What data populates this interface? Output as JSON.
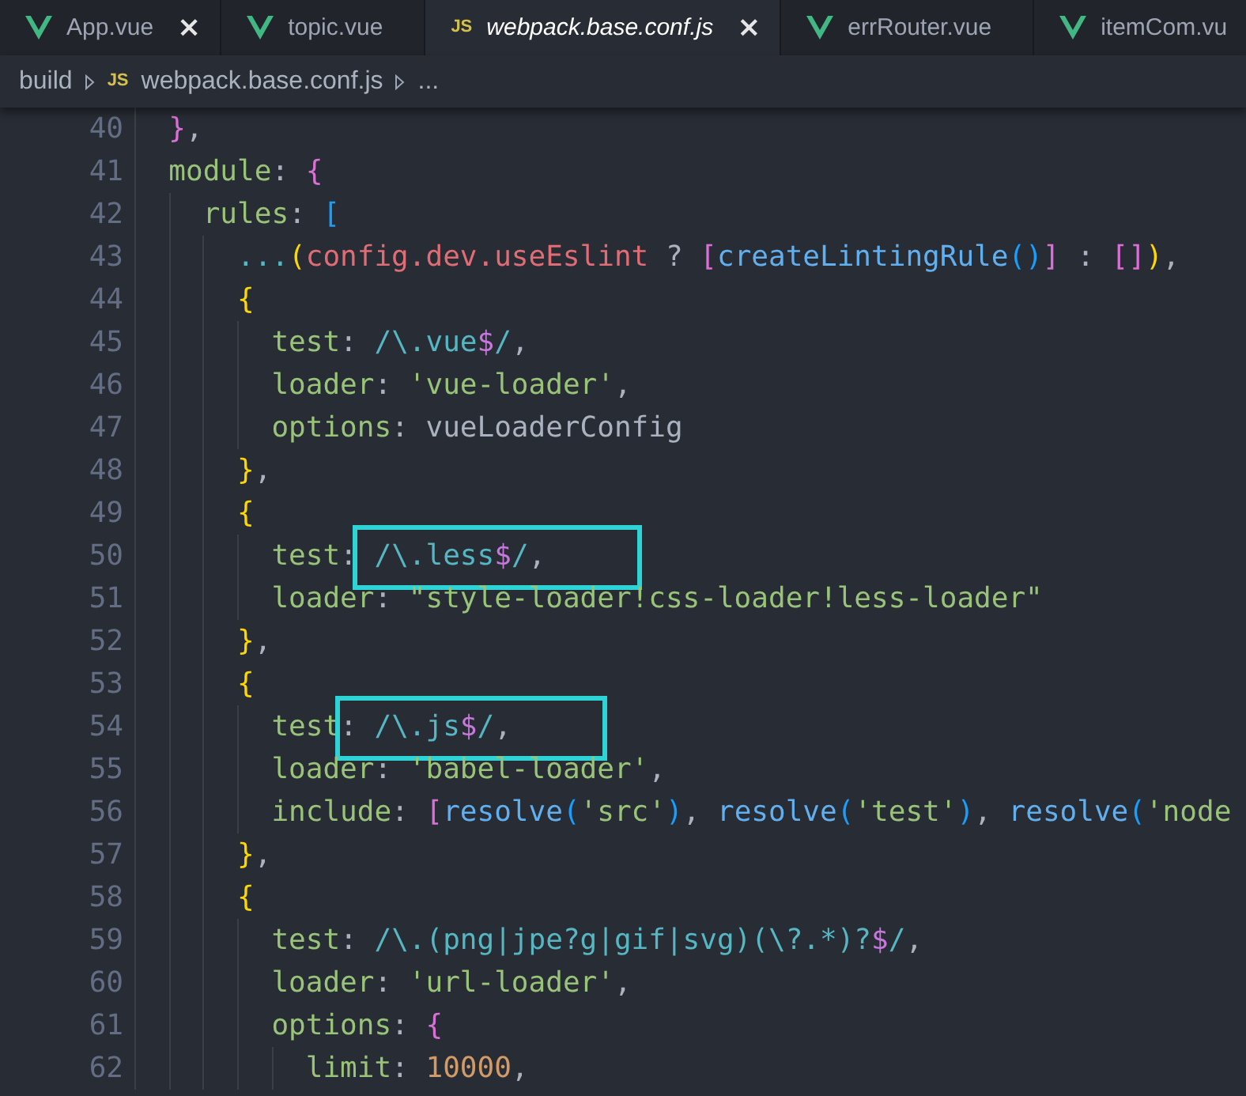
{
  "tabs": [
    {
      "label": "App.vue",
      "icon": {
        "kind": "vue"
      },
      "close": "×",
      "selected": false,
      "preview": false
    },
    {
      "label": "topic.vue",
      "icon": {
        "kind": "vue"
      },
      "selected": false,
      "preview": false
    },
    {
      "label": "webpack.base.conf.js",
      "icon": {
        "kind": "js",
        "text": "JS"
      },
      "close": "×",
      "selected": true,
      "preview": true
    },
    {
      "label": "errRouter.vue",
      "icon": {
        "kind": "vue"
      },
      "selected": false,
      "preview": false
    },
    {
      "label": "itemCom.vu",
      "icon": {
        "kind": "vue"
      },
      "selected": false,
      "preview": false
    }
  ],
  "breadcrumb": [
    {
      "label": "build"
    },
    {
      "label": "webpack.base.conf.js",
      "icon": {
        "kind": "js",
        "text": "JS"
      }
    },
    {
      "label": "..."
    }
  ],
  "code_lines": [
    {
      "number": "40",
      "tokens": [
        {
          "text": "  }",
          "kind": "brace_magenta"
        },
        {
          "text": ",",
          "kind": "punct"
        }
      ]
    },
    {
      "number": "41",
      "tokens": [
        {
          "text": "  module",
          "kind": "key"
        },
        {
          "text": ": ",
          "kind": "punct"
        },
        {
          "text": "{",
          "kind": "brace_magenta"
        }
      ]
    },
    {
      "number": "42",
      "tokens": [
        {
          "text": "    rules",
          "kind": "key"
        },
        {
          "text": ": ",
          "kind": "punct"
        },
        {
          "text": "[",
          "kind": "brace_blue"
        }
      ]
    },
    {
      "number": "43",
      "tokens": [
        {
          "text": "      ...",
          "kind": "operator"
        },
        {
          "text": "(",
          "kind": "brace_yellow"
        },
        {
          "text": "config.dev.useEslint",
          "kind": "variable"
        },
        {
          "text": " ? ",
          "kind": "punct"
        },
        {
          "text": "[",
          "kind": "brace_magenta"
        },
        {
          "text": "createLintingRule",
          "kind": "function"
        },
        {
          "text": "()",
          "kind": "brace_blue"
        },
        {
          "text": "]",
          "kind": "brace_magenta"
        },
        {
          "text": " : ",
          "kind": "punct"
        },
        {
          "text": "[]",
          "kind": "brace_magenta"
        },
        {
          "text": ")",
          "kind": "brace_yellow"
        },
        {
          "text": ",",
          "kind": "punct"
        }
      ]
    },
    {
      "number": "44",
      "tokens": [
        {
          "text": "      {",
          "kind": "brace_yellow"
        }
      ]
    },
    {
      "number": "45",
      "tokens": [
        {
          "text": "        test",
          "kind": "key"
        },
        {
          "text": ": ",
          "kind": "punct"
        },
        {
          "text": "/\\.vue",
          "kind": "regex"
        },
        {
          "text": "$",
          "kind": "regex_meta"
        },
        {
          "text": "/",
          "kind": "regex"
        },
        {
          "text": ",",
          "kind": "punct"
        }
      ]
    },
    {
      "number": "46",
      "tokens": [
        {
          "text": "        loader",
          "kind": "key"
        },
        {
          "text": ": ",
          "kind": "punct"
        },
        {
          "text": "'vue-loader'",
          "kind": "string"
        },
        {
          "text": ",",
          "kind": "punct"
        }
      ]
    },
    {
      "number": "47",
      "tokens": [
        {
          "text": "        options",
          "kind": "key"
        },
        {
          "text": ": ",
          "kind": "punct"
        },
        {
          "text": "vueLoaderConfig",
          "kind": "plain"
        }
      ]
    },
    {
      "number": "48",
      "tokens": [
        {
          "text": "      }",
          "kind": "brace_yellow"
        },
        {
          "text": ",",
          "kind": "punct"
        }
      ]
    },
    {
      "number": "49",
      "tokens": [
        {
          "text": "      {",
          "kind": "brace_yellow"
        }
      ]
    },
    {
      "number": "50",
      "tokens": [
        {
          "text": "        test",
          "kind": "key"
        },
        {
          "text": ":",
          "kind": "punct"
        }
      ],
      "boxed_tokens": [
        {
          "text": " /\\.less",
          "kind": "regex"
        },
        {
          "text": "$",
          "kind": "regex_meta"
        },
        {
          "text": "/",
          "kind": "regex"
        },
        {
          "text": ",",
          "kind": "punct"
        }
      ]
    },
    {
      "number": "51",
      "tokens": [
        {
          "text": "        loader",
          "kind": "key"
        },
        {
          "text": ": ",
          "kind": "punct"
        },
        {
          "text": "\"style-loader!css-loader!less-loader\"",
          "kind": "string"
        }
      ]
    },
    {
      "number": "52",
      "tokens": [
        {
          "text": "      }",
          "kind": "brace_yellow"
        },
        {
          "text": ",",
          "kind": "punct"
        }
      ]
    },
    {
      "number": "53",
      "tokens": [
        {
          "text": "      {",
          "kind": "brace_yellow"
        }
      ]
    },
    {
      "number": "54",
      "tokens": [
        {
          "text": "        test",
          "kind": "key"
        }
      ],
      "boxed_tokens": [
        {
          "text": ": ",
          "kind": "punct"
        },
        {
          "text": "/\\.js",
          "kind": "regex"
        },
        {
          "text": "$",
          "kind": "regex_meta"
        },
        {
          "text": "/",
          "kind": "regex"
        },
        {
          "text": ",",
          "kind": "punct"
        }
      ]
    },
    {
      "number": "55",
      "tokens": [
        {
          "text": "        loader",
          "kind": "key"
        },
        {
          "text": ": ",
          "kind": "punct"
        },
        {
          "text": "'babel-loader'",
          "kind": "string"
        },
        {
          "text": ",",
          "kind": "punct"
        }
      ]
    },
    {
      "number": "56",
      "tokens": [
        {
          "text": "        include",
          "kind": "key"
        },
        {
          "text": ": ",
          "kind": "punct"
        },
        {
          "text": "[",
          "kind": "brace_magenta"
        },
        {
          "text": "resolve",
          "kind": "function"
        },
        {
          "text": "(",
          "kind": "brace_blue"
        },
        {
          "text": "'src'",
          "kind": "string"
        },
        {
          "text": ")",
          "kind": "brace_blue"
        },
        {
          "text": ", ",
          "kind": "punct"
        },
        {
          "text": "resolve",
          "kind": "function"
        },
        {
          "text": "(",
          "kind": "brace_blue"
        },
        {
          "text": "'test'",
          "kind": "string"
        },
        {
          "text": ")",
          "kind": "brace_blue"
        },
        {
          "text": ", ",
          "kind": "punct"
        },
        {
          "text": "resolve",
          "kind": "function"
        },
        {
          "text": "(",
          "kind": "brace_blue"
        },
        {
          "text": "'node",
          "kind": "string"
        }
      ]
    },
    {
      "number": "57",
      "tokens": [
        {
          "text": "      }",
          "kind": "brace_yellow"
        },
        {
          "text": ",",
          "kind": "punct"
        }
      ]
    },
    {
      "number": "58",
      "tokens": [
        {
          "text": "      {",
          "kind": "brace_yellow"
        }
      ]
    },
    {
      "number": "59",
      "tokens": [
        {
          "text": "        test",
          "kind": "key"
        },
        {
          "text": ": ",
          "kind": "punct"
        },
        {
          "text": "/\\.(png|jpe?g|gif|svg)(\\?.*)?",
          "kind": "regex"
        },
        {
          "text": "$",
          "kind": "regex_meta"
        },
        {
          "text": "/",
          "kind": "regex"
        },
        {
          "text": ",",
          "kind": "punct"
        }
      ]
    },
    {
      "number": "60",
      "tokens": [
        {
          "text": "        loader",
          "kind": "key"
        },
        {
          "text": ": ",
          "kind": "punct"
        },
        {
          "text": "'url-loader'",
          "kind": "string"
        },
        {
          "text": ",",
          "kind": "punct"
        }
      ]
    },
    {
      "number": "61",
      "tokens": [
        {
          "text": "        options",
          "kind": "key"
        },
        {
          "text": ": ",
          "kind": "punct"
        },
        {
          "text": "{",
          "kind": "brace_magenta"
        }
      ]
    },
    {
      "number": "62",
      "tokens": [
        {
          "text": "          limit",
          "kind": "key"
        },
        {
          "text": ": ",
          "kind": "punct"
        },
        {
          "text": "10000",
          "kind": "number"
        },
        {
          "text": ",",
          "kind": "punct"
        }
      ]
    }
  ]
}
